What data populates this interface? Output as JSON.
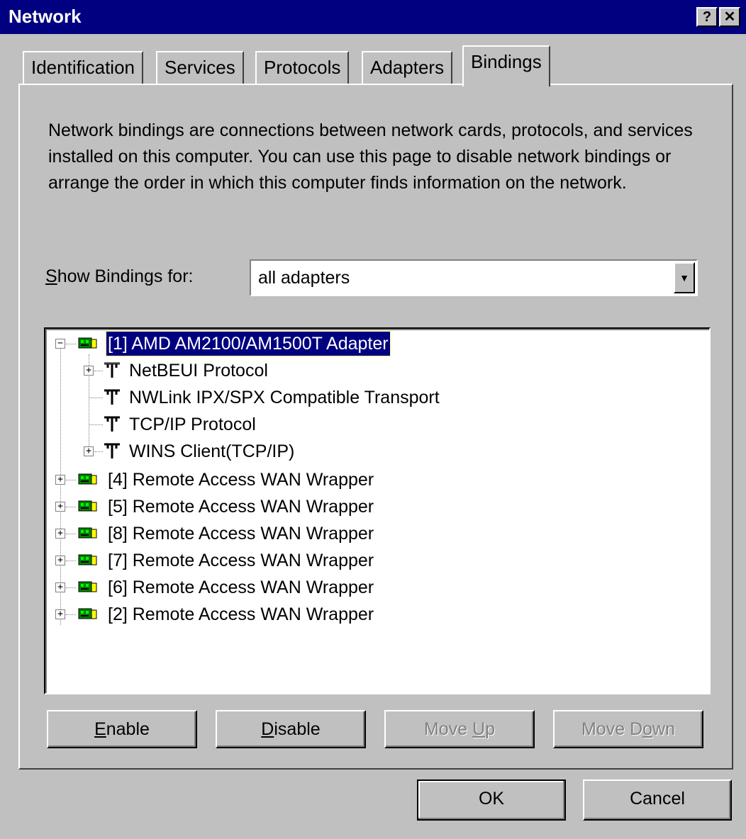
{
  "window": {
    "title": "Network",
    "help_label": "?",
    "close_label": "✕"
  },
  "tabs": [
    {
      "label": "Identification"
    },
    {
      "label": "Services"
    },
    {
      "label": "Protocols"
    },
    {
      "label": "Adapters"
    },
    {
      "label": "Bindings"
    }
  ],
  "description": "Network bindings are connections between network cards, protocols, and services installed on this computer.  You can use this page to disable network bindings or arrange the order in which this computer finds information on the network.",
  "show_bindings": {
    "label_prefix": "S",
    "label_rest": "how Bindings for:",
    "value": "all adapters",
    "arrow": "▼"
  },
  "tree": {
    "root": {
      "label": "[1] AMD AM2100/AM1500T Adapter",
      "expander": "−"
    },
    "children": [
      {
        "label": "NetBEUI Protocol",
        "expander": "+"
      },
      {
        "label": "NWLink IPX/SPX Compatible Transport",
        "expander": ""
      },
      {
        "label": "TCP/IP Protocol",
        "expander": ""
      },
      {
        "label": "WINS Client(TCP/IP)",
        "expander": "+"
      }
    ],
    "adapters": [
      {
        "label": "[4] Remote Access WAN Wrapper",
        "expander": "+"
      },
      {
        "label": "[5] Remote Access WAN Wrapper",
        "expander": "+"
      },
      {
        "label": "[8] Remote Access WAN Wrapper",
        "expander": "+"
      },
      {
        "label": "[7] Remote Access WAN Wrapper",
        "expander": "+"
      },
      {
        "label": "[6] Remote Access WAN Wrapper",
        "expander": "+"
      },
      {
        "label": "[2] Remote Access WAN Wrapper",
        "expander": "+"
      }
    ]
  },
  "buttons": {
    "enable": {
      "first": "E",
      "rest": "nable"
    },
    "disable": {
      "first": "D",
      "rest": "isable"
    },
    "move_up": {
      "before": "Move ",
      "ul": "U",
      "after": "p"
    },
    "move_down": {
      "before": "Move D",
      "ul": "o",
      "after": "wn"
    },
    "ok": "OK",
    "cancel": "Cancel"
  },
  "icons": {
    "adapter": "network-adapter-icon",
    "protocol": "protocol-icon"
  },
  "colors": {
    "selection": "#000080",
    "face": "#c0c0c0",
    "titlebar": "#000080"
  }
}
